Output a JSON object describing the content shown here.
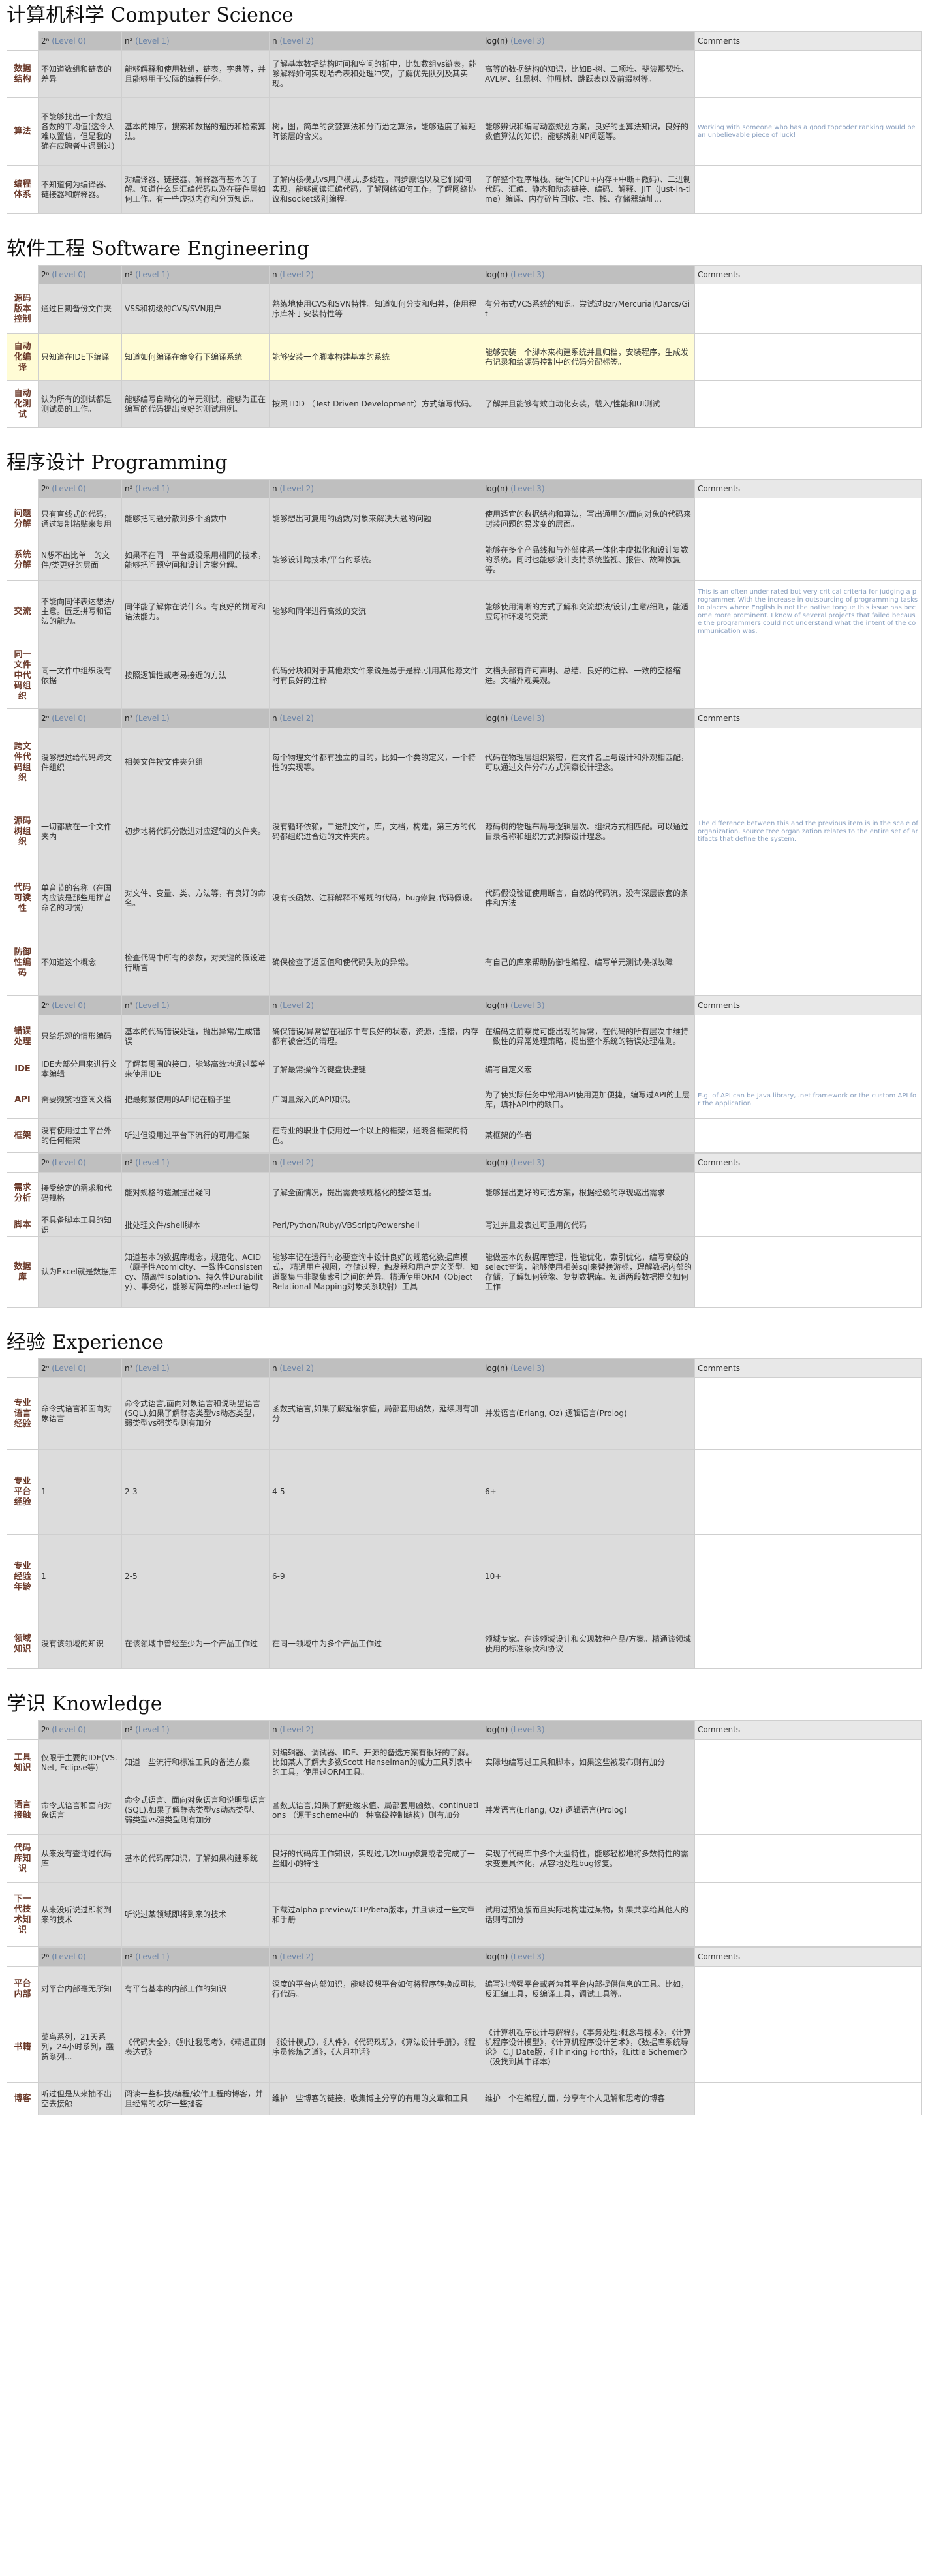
{
  "sections": [
    {
      "title": "计算机科学 Computer Science",
      "blocks": [
        {
          "header": [
            "2ⁿ (Level 0)",
            "n² (Level 1)",
            "n (Level 2)",
            "log(n) (Level 3)",
            "Comments"
          ],
          "rows": [
            {
              "cat": "数据结构",
              "cells": [
                "不知道数组和链表的差异",
                "能够解释和使用数组，链表，字典等，并且能够用于实际的编程任务。",
                "了解基本数据结构时间和空间的折中，比如数组vs链表，能够解释如何实现哈希表和处理冲突，了解优先队列及其实现。",
                "高等的数据结构的知识，比如B-树、二项堆、斐波那契堆、AVL树、红黑树、伸展树、跳跃表以及前缀树等。"
              ],
              "comment": "",
              "h": 72
            },
            {
              "cat": "算法",
              "cells": [
                "不能够找出一个数组各数的平均值(这令人难以置信，但是我的确在应聘者中遇到过)",
                "基本的排序，搜索和数据的遍历和检索算法。",
                "树，图，简单的贪婪算法和分而治之算法，能够适度了解矩阵该层的含义。",
                "能够辨识和编写动态规划方案，良好的图算法知识，良好的数值算法的知识，能够辨别NP问题等。"
              ],
              "comment": "Working with someone who has a good topcoder ranking would be an unbelievable piece of luck!",
              "h": 104
            },
            {
              "cat": "编程体系",
              "cells": [
                "不知道何为编译器、链接器和解释器。",
                "对编译器、链接器、解释器有基本的了解。知道什么是汇编代码以及在硬件层如何工作。有一些虚拟内存和分页知识。",
                "了解内核模式vs用户模式,多线程，同步原语以及它们如何实现，能够阅读汇编代码，了解网络如何工作，了解网络协议和socket级别编程。",
                "了解整个程序堆栈、硬件(CPU+内存+中断+微码)、二进制代码、汇编、静态和动态链接、编码、解释、JIT（just-in-time）编译、内存碎片回收、堆、栈、存储器编址…"
              ],
              "comment": "",
              "h": 74
            }
          ]
        }
      ]
    },
    {
      "title": "软件工程 Software Engineering",
      "blocks": [
        {
          "header": [
            "2ⁿ (Level 0)",
            "n² (Level 1)",
            "n (Level 2)",
            "log(n) (Level 3)",
            "Comments"
          ],
          "rows": [
            {
              "cat": "源码版本控制",
              "cells": [
                "通过日期备份文件夹",
                "VSS和初级的CVS/SVN用户",
                "熟练地使用CVS和SVN特性。知道如何分支和归并，使用程序库补丁安装特性等",
                "有分布式VCS系统的知识。尝试过Bzr/Mercurial/Darcs/Git"
              ],
              "comment": "",
              "h": 76,
              "hl": false
            },
            {
              "cat": "自动化编译",
              "cells": [
                "只知道在IDE下编译",
                "知道如何编译在命令行下编译系统",
                "能够安装一个脚本构建基本的系统",
                "能够安装一个脚本来构建系统并且归档，安装程序，生成发布记录和给源码控制中的代码分配标签。"
              ],
              "comment": "",
              "h": 72,
              "hl": true
            },
            {
              "cat": "自动化测试",
              "cells": [
                "认为所有的测试都是测试员的工作。",
                "能够编写自动化的单元测试，能够为正在编写的代码提出良好的测试用例。",
                "按照TDD （Test Driven Development）方式编写代码。",
                "了解并且能够有效自动化安装，载入/性能和UI测试"
              ],
              "comment": "",
              "h": 72,
              "hl": false
            }
          ]
        }
      ]
    },
    {
      "title": "程序设计 Programming",
      "blocks": [
        {
          "header": [
            "2ⁿ (Level 0)",
            "n² (Level 1)",
            "n (Level 2)",
            "log(n) (Level 3)",
            "Comments"
          ],
          "rows": [
            {
              "cat": "问题分解",
              "cells": [
                "只有直线式的代码，通过复制粘贴来复用",
                "能够把问题分散到多个函数中",
                "能够想出可复用的函数/对象来解决大题的问题",
                "使用适宜的数据结构和算法，写出通用的/面向对象的代码来封装问题的易改变的层面。"
              ],
              "comment": "",
              "h": 64
            },
            {
              "cat": "系统分解",
              "cells": [
                "N想不出比单一的文件/类更好的层面",
                "如果不在同一平台或没采用相同的技术，能够把问题空间和设计方案分解。",
                "能够设计跨技术/平台的系统。",
                "能够在多个产品线和与外部体系一体化中虚拟化和设计复数的系统。同时也能够设计支持系统监视、报告、故障恢复等。"
              ],
              "comment": "",
              "h": 62
            },
            {
              "cat": "交流",
              "cells": [
                "不能向同伴表达想法/主意。匮乏拼写和语法的能力。",
                "同伴能了解你在说什么。有良好的拼写和语法能力。",
                "能够和同伴进行高效的交流",
                "能够使用清晰的方式了解和交流想法/设计/主意/细则，能适应每种环境的交流"
              ],
              "comment": "This is an often under rated but very critical criteria for judging a programmer. With the increase in outsourcing of programming tasks to places where English is not the native tongue this issue has become more prominent. I know of several projects that failed because the programmers could not understand what the intent of the communication was.",
              "h": 96
            },
            {
              "cat": "同一文件中代码组织",
              "cells": [
                "同一文件中组织没有依据",
                "按照逻辑性或者易接近的方法",
                "代码分块和对于其他源文件来说是易于是释,引用其他源文件时有良好的注释",
                "文档头部有许可声明、总结、良好的注释、一致的空格缩进。文档外观美观。"
              ],
              "comment": "",
              "h": 100
            }
          ]
        },
        {
          "header": [
            "2ⁿ (Level 0)",
            "n² (Level 1)",
            "n (Level 2)",
            "log(n) (Level 3)",
            "Comments"
          ],
          "rows": [
            {
              "cat": "跨文件代码组织",
              "cells": [
                "没够想过给代码跨文件组织",
                "相关文件按文件夹分组",
                "每个物理文件都有独立的目的，比如一个类的定义，一个特性的实现等。",
                "代码在物理层组织紧密，在文件名上与设计和外观相匹配，可以通过文件分布方式洞察设计理念。"
              ],
              "comment": "",
              "h": 106
            },
            {
              "cat": "源码树组织",
              "cells": [
                "一切都放在一个文件夹内",
                "初步地将代码分散进对应逻辑的文件夹。",
                "没有循环依赖，二进制文件，库，文档，构建，第三方的代码都组织进合适的文件夹内。",
                "源码树的物理布局与逻辑层次、组织方式相匹配。可以通过目录名称和组织方式洞察设计理念。"
              ],
              "comment": "The difference between this and the previous item is in the scale of organization, source tree organization relates to the entire set of artifacts that define the system.",
              "h": 106
            },
            {
              "cat": "代码可读性",
              "cells": [
                "单音节的名称（在国内应该是那些用拼音命名的习惯）",
                "对文件、变量、类、方法等，有良好的命名。",
                "没有长函数、注释解释不常规的代码，bug修复,代码假设。",
                "代码假设验证使用断言，自然的代码流，没有深层嵌套的条件和方法"
              ],
              "comment": "",
              "h": 98
            },
            {
              "cat": "防御性编码",
              "cells": [
                "不知道这个概念",
                "检查代码中所有的参数，对关键的假设进行断言",
                "确保检查了返回值和使代码失败的异常。",
                "有自己的库来帮助防御性编程、编写单元测试模拟故障"
              ],
              "comment": "",
              "h": 100
            }
          ]
        },
        {
          "header": [
            "2ⁿ (Level 0)",
            "n² (Level 1)",
            "n (Level 2)",
            "log(n) (Level 3)",
            "Comments"
          ],
          "rows": [
            {
              "cat": "错误处理",
              "cells": [
                "只给乐观的情形编码",
                "基本的代码错误处理，抛出异常/生成错误",
                "确保错误/异常留在程序中有良好的状态，资源，连接，内存都有被合适的清理。",
                "在编码之前察觉可能出现的异常，在代码的所有层次中维持一致性的异常处理策略，提出整个系统的错误处理准则。"
              ],
              "comment": "",
              "h": 66
            },
            {
              "cat": "IDE",
              "cells": [
                "IDE大部分用来进行文本编辑",
                "了解其周围的接口，能够高效地通过菜单来使用IDE",
                "了解最常操作的键盘快捷键",
                "编写自定义宏"
              ],
              "comment": "",
              "h": 32
            },
            {
              "cat": "API",
              "cells": [
                "需要频繁地查阅文档",
                "把最频繁使用的API记在脑子里",
                "广阔且深入的API知识。",
                "为了使实际任务中常用API使用更加便捷，编写过API的上层库，填补API中的缺口。"
              ],
              "comment": "E.g. of API can be Java library, .net framework or the custom API for the application",
              "h": 58
            },
            {
              "cat": "框架",
              "cells": [
                "没有使用过主平台外的任何框架",
                "听过但没用过平台下流行的可用框架",
                "在专业的职业中使用过一个以上的框架，通晓各框架的特色。",
                "某框架的作者"
              ],
              "comment": "",
              "h": 52
            }
          ]
        },
        {
          "header": [
            "2ⁿ (Level 0)",
            "n² (Level 1)",
            "n (Level 2)",
            "log(n) (Level 3)",
            "Comments"
          ],
          "rows": [
            {
              "cat": "需求分析",
              "cells": [
                "接受给定的需求和代码规格",
                "能对规格的遗漏提出疑问",
                "了解全面情况，提出需要被规格化的整体范围。",
                "能够提出更好的可选方案，根据经验的浮现驱出需求"
              ],
              "comment": "",
              "h": 64
            },
            {
              "cat": "脚本",
              "cells": [
                "不具备脚本工具的知识",
                "批处理文件/shell脚本",
                "Perl/Python/Ruby/VBScript/Powershell",
                "写过并且发表过可重用的代码"
              ],
              "comment": "",
              "h": 32
            },
            {
              "cat": "数据库",
              "cells": [
                "认为Excel就是数据库",
                "知道基本的数据库概念，规范化、ACID（原子性Atomicity、一致性Consistency、隔离性Isolation、持久性Durability）、事务化，能够写简单的select语句",
                "能够牢记在运行时必要查询中设计良好的规范化数据库模式， 精通用户视图，存储过程，触发器和用户定义类型。知道聚集与非聚集索引之间的差异。精通使用ORM（Object Relational Mapping对象关系映射）工具",
                "能做基本的数据库管理，性能优化，索引优化，编写高级的select查询，能够使用相关sql来替换游标，理解数据内部的存储，了解如何镜像、复制数据库。知道两段数据提交如何工作"
              ],
              "comment": "",
              "h": 108
            }
          ]
        }
      ]
    },
    {
      "title": "经验 Experience",
      "blocks": [
        {
          "header": [
            "2ⁿ (Level 0)",
            "n² (Level 1)",
            "n (Level 2)",
            "log(n) (Level 3)",
            "Comments"
          ],
          "rows": [
            {
              "cat": "专业语言经验",
              "cells": [
                "命令式语言和面向对象语言",
                "命令式语言,面向对象语言和说明型语言(SQL),如果了解静态类型vs动态类型，弱类型vs强类型则有加分",
                "函数式语言,如果了解延缓求值，局部套用函数，延续则有加分",
                "并发语言(Erlang, Oz) 逻辑语言(Prolog)"
              ],
              "comment": "",
              "h": 110
            },
            {
              "cat": "专业平台经验",
              "cells": [
                "1",
                "2-3",
                "4-5",
                "6+"
              ],
              "comment": "",
              "h": 130
            },
            {
              "cat": "专业经验年龄",
              "cells": [
                "1",
                "2-5",
                "6-9",
                "10+"
              ],
              "comment": "",
              "h": 130
            },
            {
              "cat": "领域知识",
              "cells": [
                "没有该领域的知识",
                "在该领域中曾经至少为一个产品工作过",
                "在同一领域中为多个产品工作过",
                "领域专家。在该领域设计和实现数种产品/方案。精通该领域使用的标准条款和协议"
              ],
              "comment": "",
              "h": 76
            }
          ]
        }
      ]
    },
    {
      "title": "学识 Knowledge",
      "blocks": [
        {
          "header": [
            "2ⁿ (Level 0)",
            "n² (Level 1)",
            "n (Level 2)",
            "log(n) (Level 3)",
            "Comments"
          ],
          "rows": [
            {
              "cat": "工具知识",
              "cells": [
                "仅限于主要的IDE(VS.Net, Eclipse等)",
                "知道一些流行和标准工具的备选方案",
                "对编辑器、调试器、IDE、开源的备选方案有很好的了解。比如某人了解大多数Scott Hanselman的威力工具列表中的工具，使用过ORM工具。",
                "实际地编写过工具和脚本，如果这些被发布则有加分"
              ],
              "comment": "",
              "h": 72
            },
            {
              "cat": "语言接触",
              "cells": [
                "命令式语言和面向对象语言",
                "命令式语言、面向对象语言和说明型语言(SQL),如果了解静态类型vs动态类型、弱类型vs强类型则有加分",
                "函数式语言,如果了解延缓求值、局部套用函数、continuations （源于scheme中的一种高级控制结构）则有加分",
                "并发语言(Erlang, Oz) 逻辑语言(Prolog)"
              ],
              "comment": "",
              "h": 74
            },
            {
              "cat": "代码库知识",
              "cells": [
                "从来没有查询过代码库",
                "基本的代码库知识，了解如果构建系统",
                "良好的代码库工作知识，实现过几次bug修复或者完成了一些细小的特性",
                "实现了代码库中多个大型特性，能够轻松地将多数特性的需求变更具体化，从容地处理bug修复。"
              ],
              "comment": "",
              "h": 74
            },
            {
              "cat": "下一代技术知识",
              "cells": [
                "从来没听说过即将到来的技术",
                "听说过某领域即将到来的技术",
                "下载过alpha preview/CTP/beta版本，并且读过一些文章和手册",
                "试用过预览版而且实际地构建过某物，如果共享给其他人的话则有加分"
              ],
              "comment": "",
              "h": 98
            }
          ]
        },
        {
          "header": [
            "2ⁿ (Level 0)",
            "n² (Level 1)",
            "n (Level 2)",
            "log(n) (Level 3)",
            "Comments"
          ],
          "rows": [
            {
              "cat": "平台内部",
              "cells": [
                "对平台内部毫无所知",
                "有平台基本的内部工作的知识",
                "深度的平台内部知识，能够设想平台如何将程序转换成可执行代码。",
                "编写过增强平台或者为其平台内部提供信息的工具。比如，反汇编工具，反编译工具，调试工具等。"
              ],
              "comment": "",
              "h": 70
            },
            {
              "cat": "书籍",
              "cells": [
                "菜鸟系列，21天系列，24小时系列，蠢货系列...",
                "《代码大全》，《别让我思考》，《精通正则表达式》",
                "《设计模式》，《人件》，《代码珠玑》，《算法设计手册》，《程序员修炼之道》，《人月神话》",
                "《计算机程序设计与解释》，《事务处理:概念与技术》，《计算机程序设计模型》，《计算机程序设计艺术》，《数据库系统导论》 C.J Date版，《Thinking Forth》，《Little Schemer》（没找到其中译本）"
              ],
              "comment": "",
              "h": 108
            },
            {
              "cat": "博客",
              "cells": [
                "听过但是从来抽不出空去接触",
                "阅读一些科技/编程/软件工程的博客，并且经常的收听一些播客",
                "维护一些博客的链接，收集博主分享的有用的文章和工具",
                "维护一个在编程方面，分享有个人见解和思考的博客"
              ],
              "comment": "",
              "h": 50
            }
          ]
        }
      ]
    }
  ]
}
